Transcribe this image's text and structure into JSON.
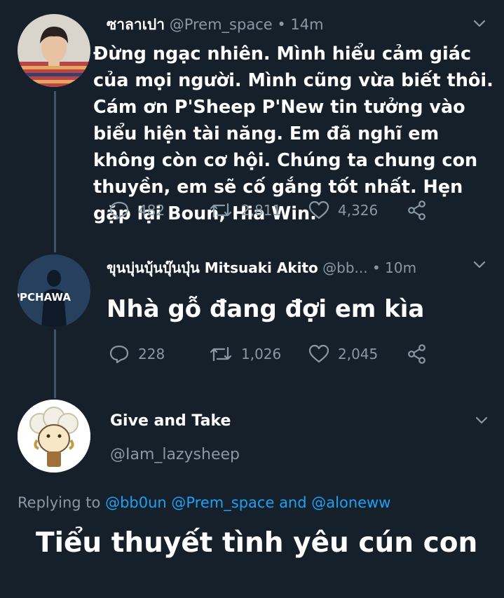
{
  "tweets": [
    {
      "display_name": "ซาลาเปา",
      "handle": "@Prem_space",
      "separator": "•",
      "time": "14m",
      "text": "Đừng ngạc nhiên. Mình hiểu cảm giác của mọi người. Mình cũng vừa biết thôi. Cám ơn P'Sheep P'New tin tưởng vào biểu hiện tài năng. Em đã nghĩ em không còn cơ hội. Chúng ta chung con thuyền, em sẽ cố gắng tốt nhất. Hẹn gặp lại Boun, Hia Win.",
      "replies": "482",
      "retweets": "2,811",
      "likes": "4,326"
    },
    {
      "display_name": "ขุนบุ่นบุ้นบุ๊นบุ๋น Mitsuaki Akito",
      "handle": "@bb...",
      "separator": "•",
      "time": "10m",
      "avatar_text": "PPCHAWA",
      "text": "Nhà gỗ đang đợi em kìa",
      "replies": "228",
      "retweets": "1,026",
      "likes": "2,045"
    }
  ],
  "main_tweet": {
    "display_name": "Give and Take",
    "handle": "@Iam_lazysheep",
    "replying_prefix": "Replying to",
    "mention_1": "@bb0un",
    "mention_2": "@Prem_space",
    "and_word": "and",
    "mention_3": "@aloneww",
    "text": "Tiểu thuyết tình yêu cún con"
  },
  "colors": {
    "background": "#15202b",
    "secondary_text": "#8899a6",
    "link": "#1da1f2",
    "thread_line": "#3d5466"
  }
}
